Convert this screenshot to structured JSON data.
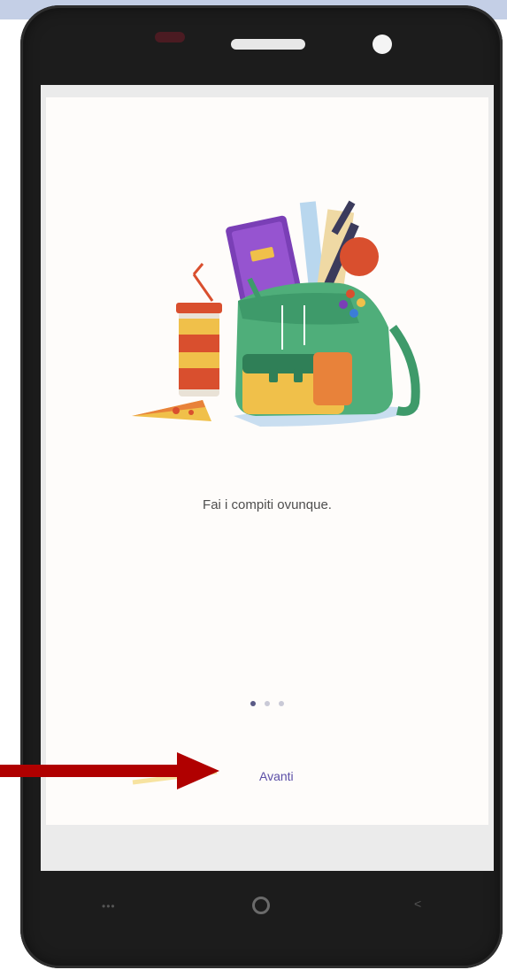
{
  "screen": {
    "caption": "Fai i compiti ovunque.",
    "next_label": "Avanti",
    "page_indicator": {
      "total": 3,
      "current": 1
    }
  },
  "nav_bar": {
    "menu_glyph": "•••",
    "back_glyph": "<"
  },
  "illustration": "backpack-illustration",
  "annotation": {
    "icon": "red-arrow-icon",
    "color": "#b00000"
  },
  "colors": {
    "link": "#5b4ea6",
    "active_dot": "#5a5a86",
    "inactive_dot": "#c9c9d6",
    "phone_body": "#1c1c1c"
  }
}
